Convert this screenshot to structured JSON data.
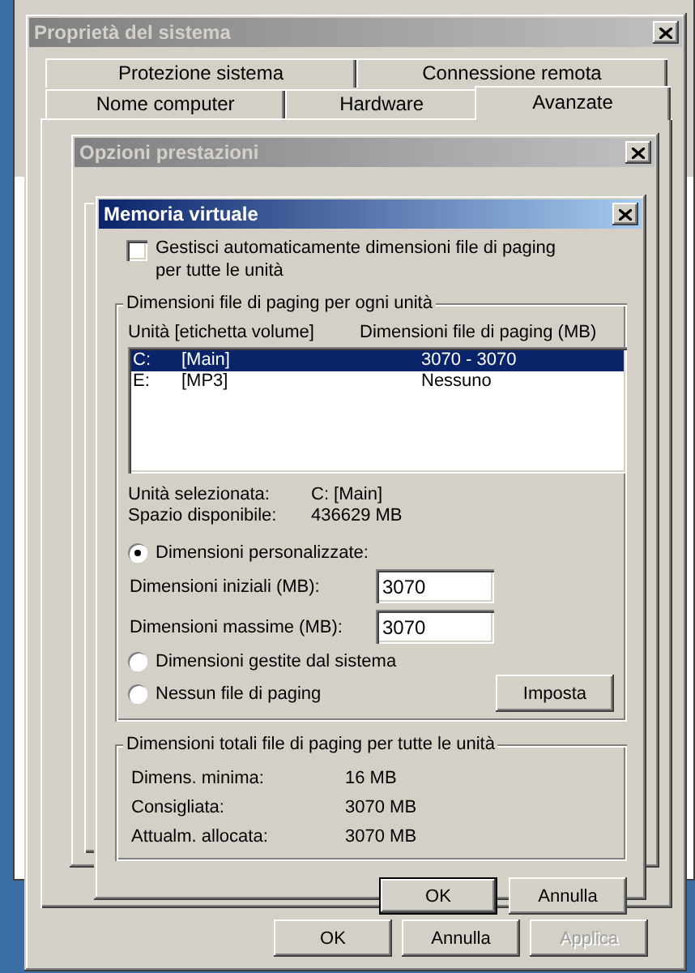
{
  "system_properties": {
    "title": "Proprietà del sistema",
    "active": false,
    "tabs_row_1": [
      {
        "label": "Protezione sistema",
        "selected": false
      },
      {
        "label": "Connessione remota",
        "selected": false
      }
    ],
    "tabs_row_2": [
      {
        "label": "Nome computer",
        "selected": false
      },
      {
        "label": "Hardware",
        "selected": false
      },
      {
        "label": "Avanzate",
        "selected": true
      }
    ],
    "buttons": [
      {
        "label": "OK",
        "disabled": false
      },
      {
        "label": "Annulla",
        "disabled": false
      },
      {
        "label": "Applica",
        "disabled": true
      }
    ]
  },
  "performance_options": {
    "title": "Opzioni prestazioni",
    "active": false
  },
  "virtual_memory": {
    "title": "Memoria virtuale",
    "active": true,
    "auto_manage": {
      "label": "Gestisci automaticamente dimensioni file di paging per tutte le unità",
      "checked": false
    },
    "drives_group": {
      "title": "Dimensioni file di paging per ogni unità",
      "columns": [
        "Unità [etichetta volume]",
        "Dimensioni file di paging (MB)"
      ],
      "rows": [
        {
          "drive": "C:",
          "label": "[Main]",
          "size": "3070 - 3070",
          "selected": true
        },
        {
          "drive": "E:",
          "label": "[MP3]",
          "size": "Nessuno",
          "selected": false
        }
      ],
      "info": [
        {
          "label": "Unità selezionata:",
          "value": "C:  [Main]"
        },
        {
          "label": "Spazio disponibile:",
          "value": "436629 MB"
        }
      ],
      "options": [
        {
          "label": "Dimensioni personalizzate:",
          "selected": true
        },
        {
          "label": "Dimensioni gestite dal sistema",
          "selected": false
        },
        {
          "label": "Nessun file di paging",
          "selected": false
        }
      ],
      "fields": [
        {
          "label": "Dimensioni iniziali (MB):",
          "value": "3070"
        },
        {
          "label": "Dimensioni massime (MB):",
          "value": "3070"
        }
      ],
      "set_button": "Imposta"
    },
    "totals_group": {
      "title": "Dimensioni totali file di paging per tutte le unità",
      "rows": [
        {
          "label": "Dimens. minima:",
          "value": "16 MB"
        },
        {
          "label": "Consigliata:",
          "value": "3070 MB"
        },
        {
          "label": "Attualm. allocata:",
          "value": "3070 MB"
        }
      ]
    },
    "buttons": [
      {
        "label": "OK",
        "default": true
      },
      {
        "label": "Annulla",
        "default": false
      }
    ]
  }
}
